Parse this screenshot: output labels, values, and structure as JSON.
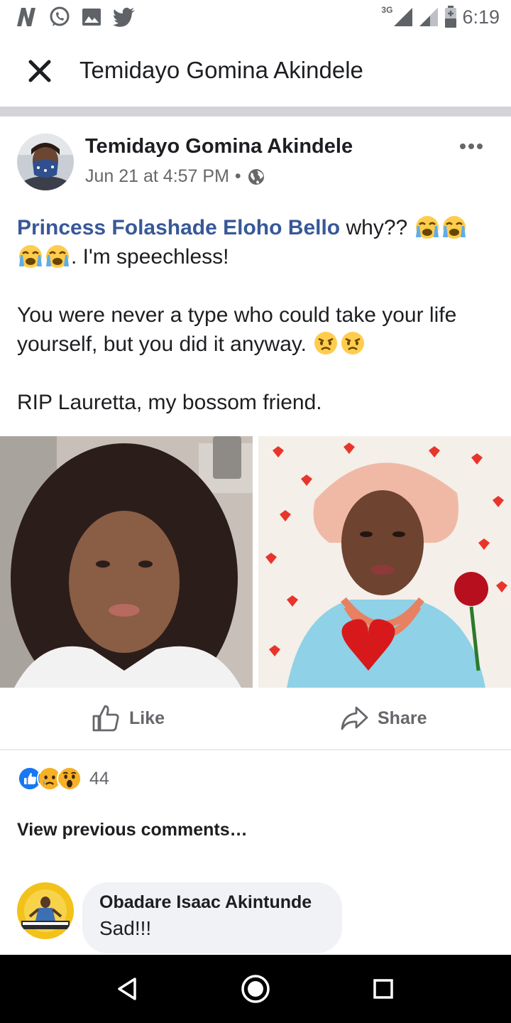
{
  "status_bar": {
    "network": "3G",
    "time": "6:19",
    "notification_icons": [
      "n-icon",
      "whatsapp-icon",
      "gallery-icon",
      "twitter-icon"
    ]
  },
  "header": {
    "title": "Temidayo Gomina Akindele"
  },
  "post": {
    "author": "Temidayo Gomina Akindele",
    "timestamp": "Jun 21 at 4:57 PM",
    "separator": "•",
    "privacy_icon": "globe-icon",
    "mention": "Princess Folashade Eloho Bello",
    "text_1a": " why?? ",
    "text_1b": ". I'm speechless!",
    "text_2": "You were never a type who could take your life yourself, but you did it anyway. ",
    "text_3": "RIP Lauretta, my bossom friend.",
    "photos": [
      "photo-woman-afro",
      "photo-woman-gele-hearts"
    ]
  },
  "actions": {
    "like_label": "Like",
    "share_label": "Share"
  },
  "reactions": {
    "icons": [
      "like-reaction-icon",
      "sad-reaction-icon",
      "wow-reaction-icon"
    ],
    "count": "44"
  },
  "comments": {
    "view_previous": "View previous comments…",
    "items": [
      {
        "author": "Obadare Isaac Akintunde",
        "text": "Sad!!!"
      }
    ]
  },
  "colors": {
    "link_blue": "#385898",
    "like_blue": "#1877f2",
    "divider": "#d2d4d8",
    "secondary_text": "#65676b"
  }
}
